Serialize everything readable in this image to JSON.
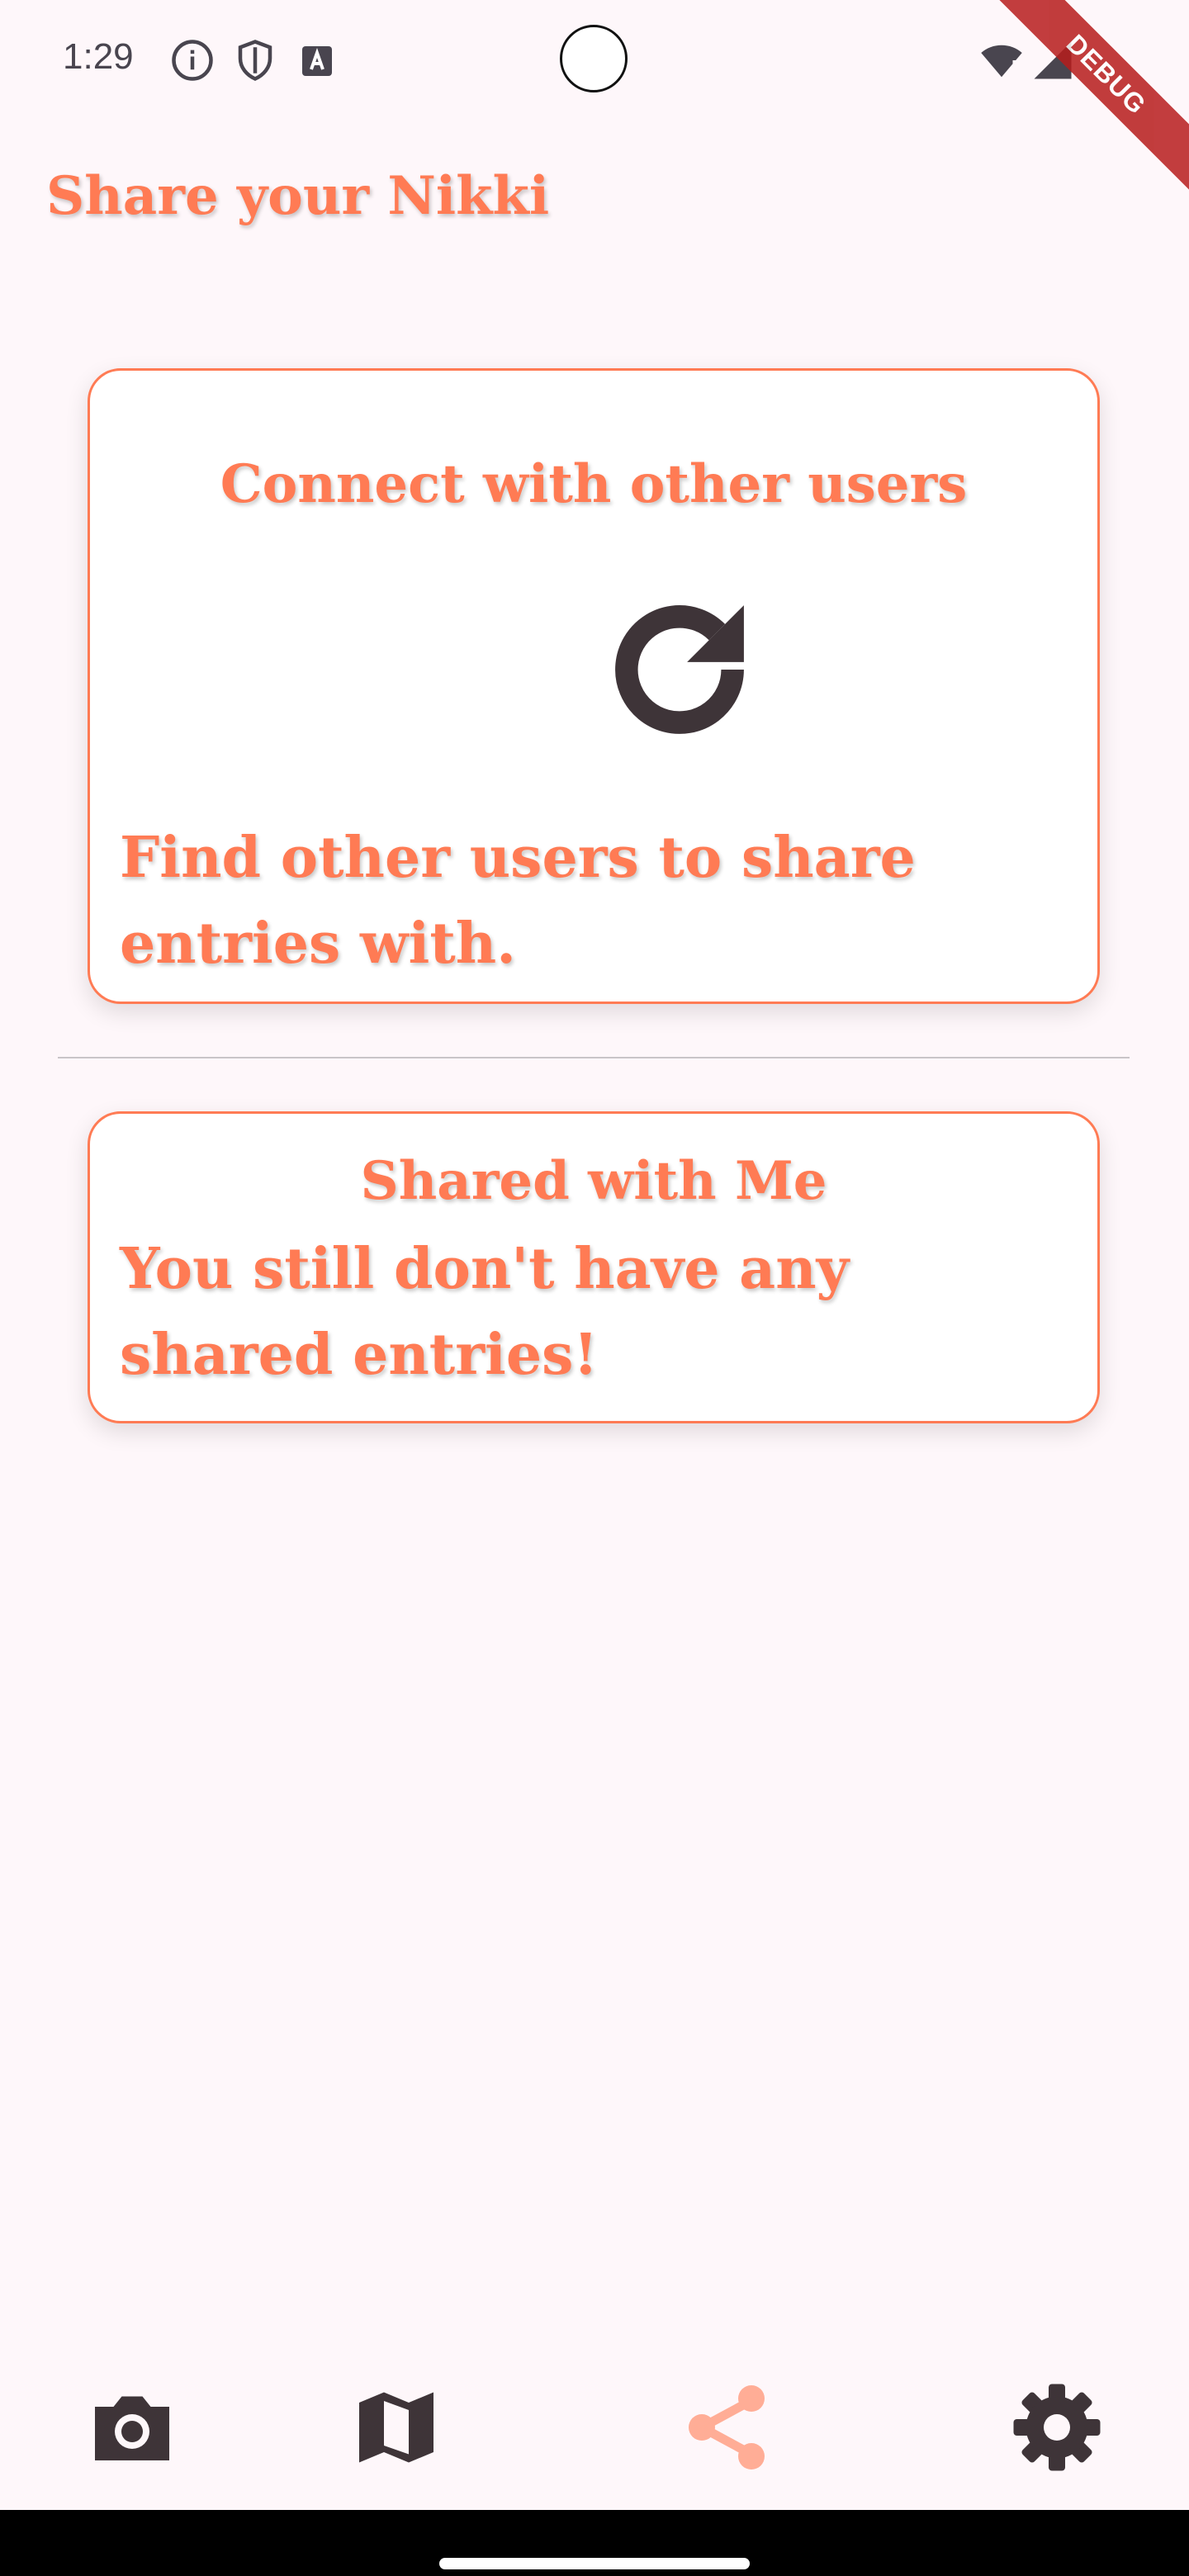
{
  "status_bar": {
    "time": "1:29",
    "icons": [
      "info-icon",
      "shield-icon",
      "font-icon",
      "wifi-alert-icon",
      "signal-icon"
    ]
  },
  "debug_banner": "DEBUG",
  "header": {
    "title": "Share your Nikki"
  },
  "connect_card": {
    "heading": "Connect with other users",
    "icon": "refresh-icon",
    "description": "Find other users to share entries with."
  },
  "shared_card": {
    "heading": "Shared with Me",
    "empty_message": "You still don't have any shared entries!"
  },
  "bottom_nav": {
    "items": [
      {
        "icon": "camera-icon",
        "active": false
      },
      {
        "icon": "map-icon",
        "active": false
      },
      {
        "icon": "share-icon",
        "active": true
      },
      {
        "icon": "settings-icon",
        "active": false
      }
    ]
  },
  "colors": {
    "accent": "#FF7B54",
    "accent_light": "#FFAD96",
    "icon_dark": "#3E3438",
    "background": "#FEF7FA"
  }
}
